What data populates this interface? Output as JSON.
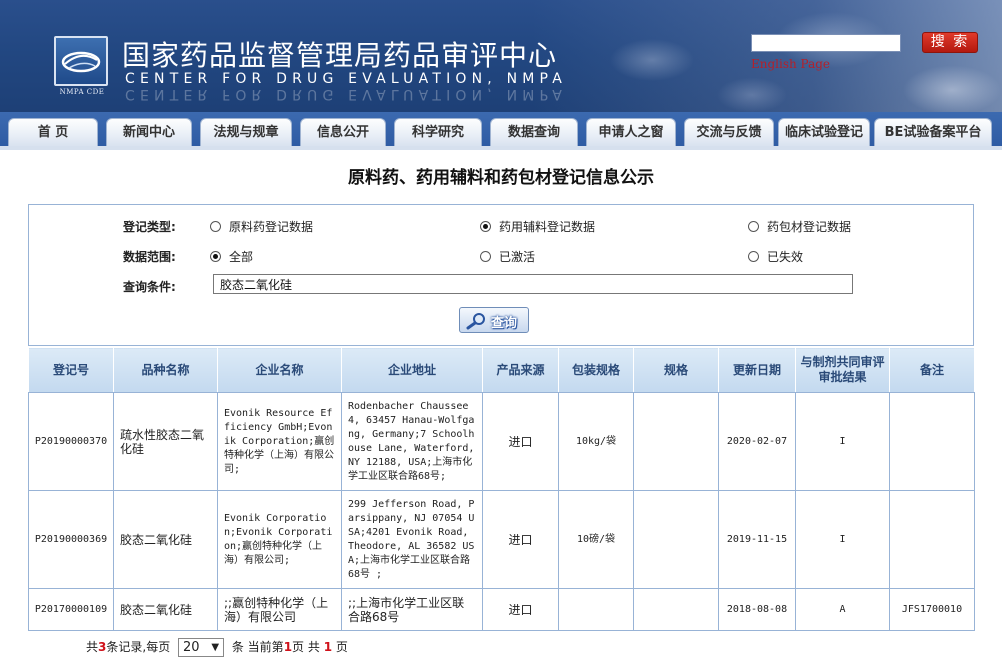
{
  "header": {
    "title_cn": "国家药品监督管理局药品审评中心",
    "title_en": "CENTER FOR DRUG EVALUATION, NMPA",
    "logo_caption": "NMPA CDE",
    "search_value": "",
    "search_button": "搜 索",
    "english_link": "English Page"
  },
  "nav": {
    "tabs": [
      "首  页",
      "新闻中心",
      "法规与规章",
      "信息公开",
      "科学研究",
      "数据查询",
      "申请人之窗",
      "交流与反馈",
      "临床试验登记",
      "BE试验备案平台"
    ]
  },
  "page": {
    "title": "原料药、药用辅料和药包材登记信息公示"
  },
  "form": {
    "type_label": "登记类型:",
    "type_options": [
      "原料药登记数据",
      "药用辅料登记数据",
      "药包材登记数据"
    ],
    "type_selected": "药用辅料登记数据",
    "scope_label": "数据范围:",
    "scope_options": [
      "全部",
      "已激活",
      "已失效"
    ],
    "scope_selected": "全部",
    "query_label": "查询条件:",
    "query_value": "胶态二氧化硅",
    "query_button": "查询"
  },
  "table": {
    "headers": [
      "登记号",
      "品种名称",
      "企业名称",
      "企业地址",
      "产品来源",
      "包装规格",
      "规格",
      "更新日期",
      "与制剂共同审评审批结果",
      "备注"
    ],
    "rows": [
      {
        "reg_no": "P20190000370",
        "product": "疏水性胶态二氧化硅",
        "company": "Evonik Resource Efficiency GmbH;Evonik Corporation;赢创特种化学（上海）有限公司;",
        "address": "Rodenbacher Chaussee 4, 63457 Hanau-Wolfgang, Germany;7 Schoolhouse Lane, Waterford, NY 12188, USA;上海市化学工业区联合路68号;",
        "source": "进口",
        "package": "10kg/袋",
        "spec": "",
        "updated": "2020-02-07",
        "result": "I",
        "remark": ""
      },
      {
        "reg_no": "P20190000369",
        "product": "胶态二氧化硅",
        "company": "Evonik Corporation;Evonik Corporation;赢创特种化学（上海）有限公司;",
        "address": "299 Jefferson Road, Parsippany, NJ 07054 USA;4201 Evonik Road, Theodore, AL 36582 USA;上海市化学工业区联合路68号 ;",
        "source": "进口",
        "package": "10磅/袋",
        "spec": "",
        "updated": "2019-11-15",
        "result": "I",
        "remark": ""
      },
      {
        "reg_no": "P20170000109",
        "product": "胶态二氧化硅",
        "company": ";;赢创特种化学（上海）有限公司",
        "address": ";;上海市化学工业区联合路68号",
        "source": "进口",
        "package": "",
        "spec": "",
        "updated": "2018-08-08",
        "result": "A",
        "remark": "JFS1700010"
      }
    ]
  },
  "pager": {
    "prefix": "共",
    "total": "3",
    "mid1": "条记录,每页",
    "page_size": "20",
    "mid2": "条 当前第",
    "current": "1",
    "mid3": "页 共",
    "pages": "1",
    "suffix": "页"
  }
}
